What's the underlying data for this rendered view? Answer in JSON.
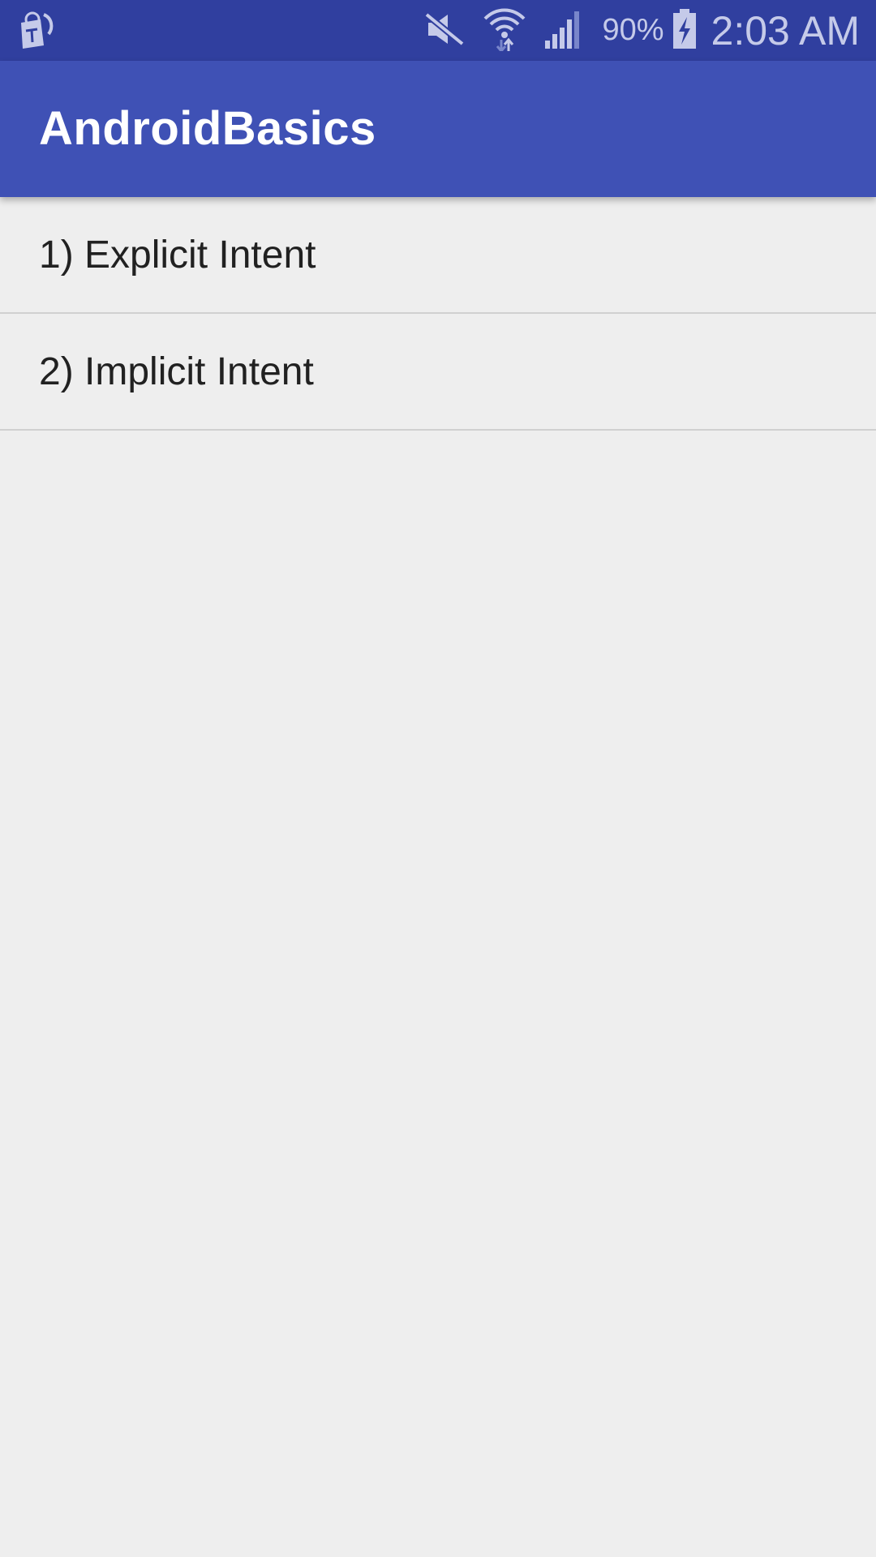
{
  "status_bar": {
    "notification_icon": "tmobile-app-icon",
    "icons": [
      "mute-icon",
      "wifi-icon",
      "signal-icon",
      "battery-charging-icon"
    ],
    "battery_percent": "90%",
    "time": "2:03 AM"
  },
  "app_bar": {
    "title": "AndroidBasics"
  },
  "list": {
    "items": [
      {
        "label": "1) Explicit Intent"
      },
      {
        "label": "2) Implicit Intent"
      }
    ]
  },
  "colors": {
    "status_bar": "#303f9f",
    "app_bar": "#3f51b5",
    "background": "#eeeeee",
    "divider": "#d0d0d0",
    "text_primary": "#212121"
  }
}
